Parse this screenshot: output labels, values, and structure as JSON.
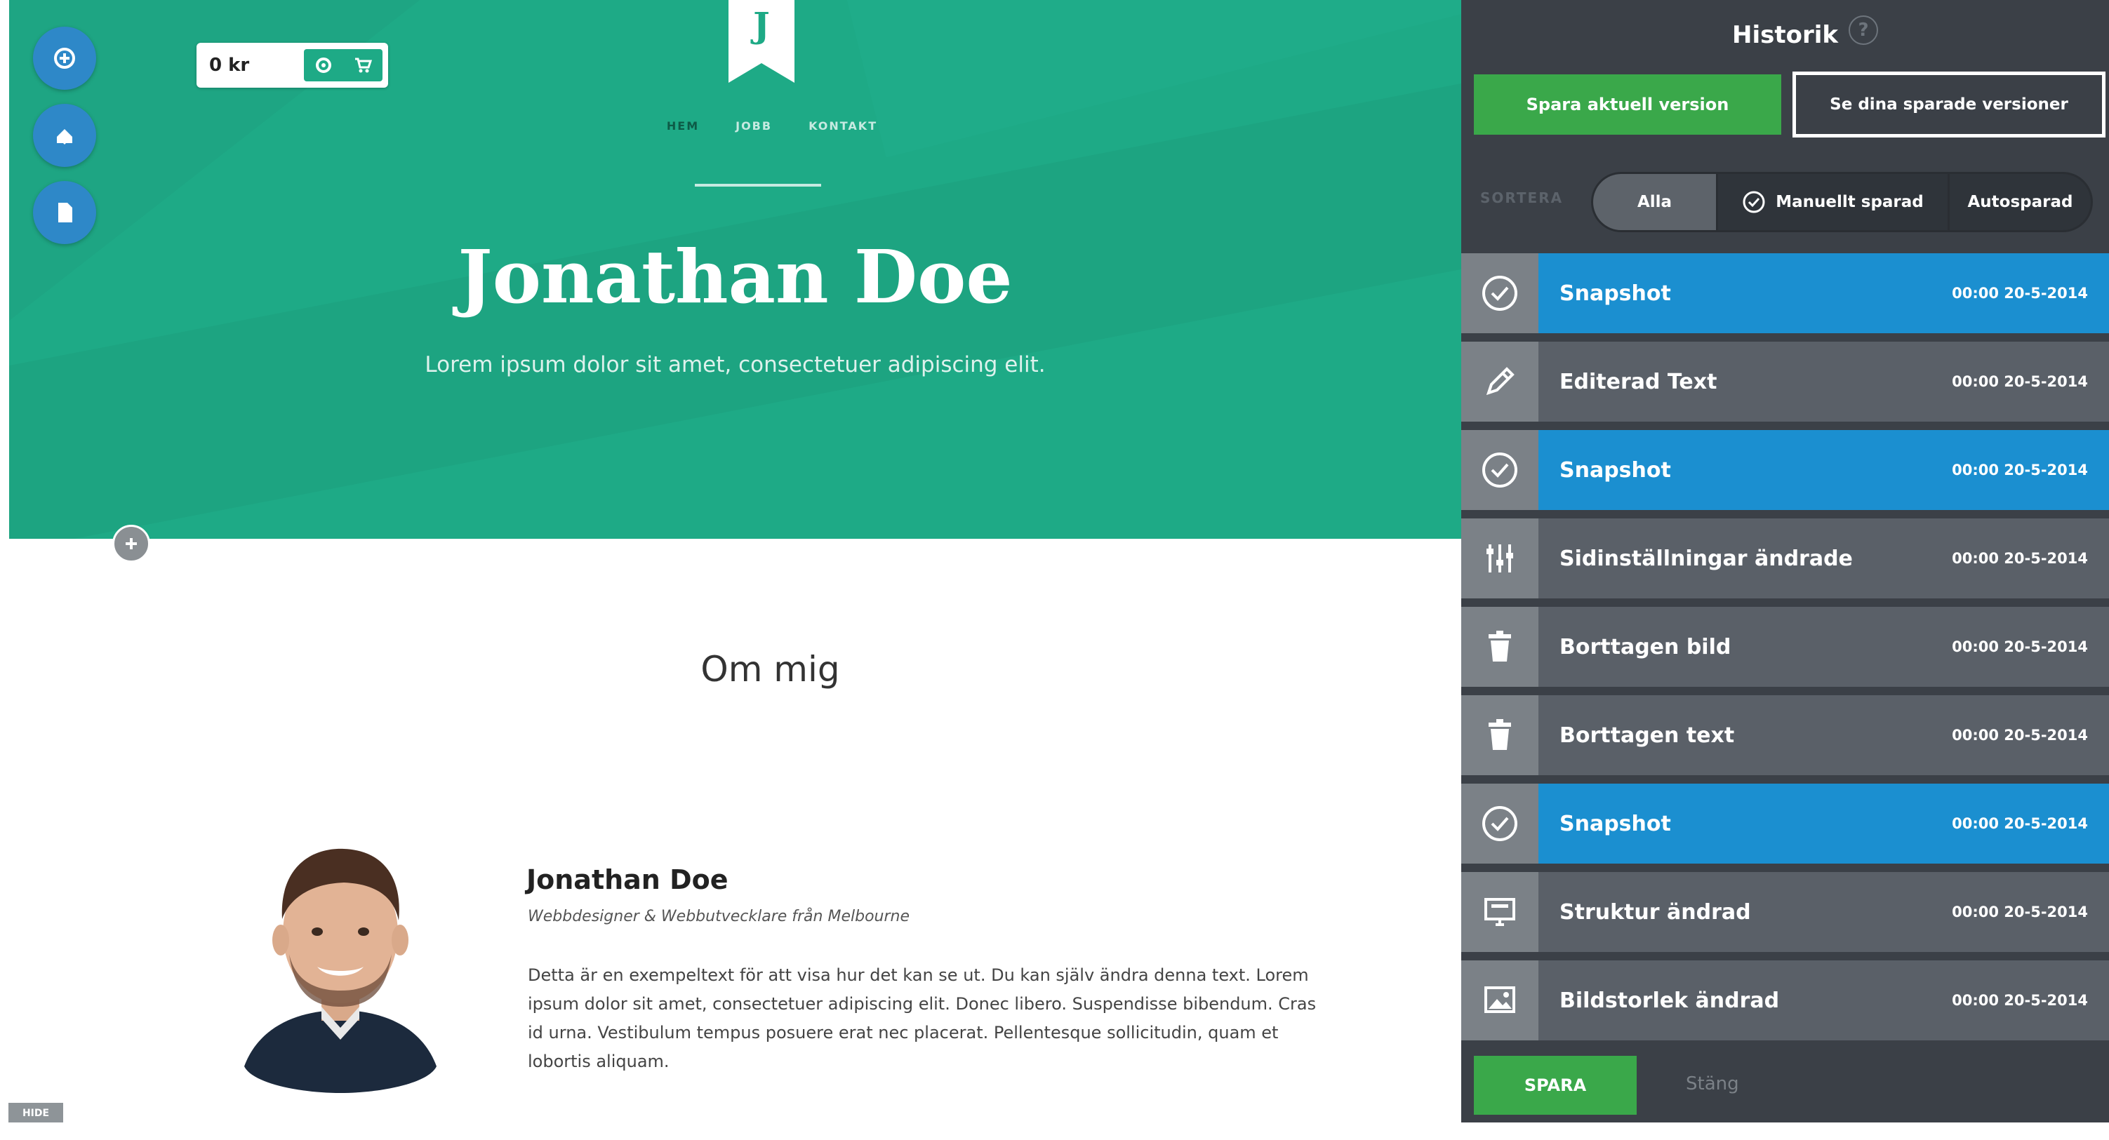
{
  "colors": {
    "hero_green": "#1eaa86",
    "panel_dark": "#3b4047",
    "snapshot_blue": "#1b8fd0",
    "action_green": "#3aa84a",
    "fab_blue": "#2e88c8"
  },
  "editor": {
    "tool_buttons": [
      {
        "icon": "plus-circle-icon"
      },
      {
        "icon": "paint-bucket-icon"
      },
      {
        "icon": "page-icon"
      }
    ],
    "cart": {
      "amount": "0 kr",
      "icons": [
        "gear-icon",
        "cart-icon"
      ]
    },
    "logo_letter": "J",
    "nav": [
      "HEM",
      "JOBB",
      "KONTAKT"
    ],
    "hero_title": "Jonathan Doe",
    "hero_subtitle": "Lorem ipsum dolor sit amet, consectetuer adipiscing elit.",
    "about_heading": "Om mig",
    "profile": {
      "name": "Jonathan Doe",
      "role": "Webbdesigner & Webbutvecklare från Melbourne",
      "bio": "Detta är en exempeltext för att visa hur det kan se ut. Du kan själv ändra denna text. Lorem ipsum dolor sit amet, consectetuer adipiscing elit. Donec libero. Suspendisse bibendum. Cras id urna. Vestibulum tempus posuere erat nec placerat. Pellentesque sollicitudin, quam et lobortis aliquam."
    },
    "corner_tag": "HIDE"
  },
  "panel": {
    "title": "Historik",
    "help": "?",
    "save_version_label": "Spara aktuell version",
    "saved_versions_label": "Se dina sparade versioner",
    "sort_label": "SORTERA",
    "sort_options": [
      "Alla",
      "Manuellt sparad",
      "Autosparad"
    ],
    "sort_selected": "Alla",
    "history": [
      {
        "label": "Snapshot",
        "time": "00:00 20-5-2014",
        "icon": "check-circle-icon",
        "type": "snapshot"
      },
      {
        "label": "Editerad Text",
        "time": "00:00 20-5-2014",
        "icon": "pencil-icon",
        "type": "edit"
      },
      {
        "label": "Snapshot",
        "time": "00:00 20-5-2014",
        "icon": "check-circle-icon",
        "type": "snapshot"
      },
      {
        "label": "Sidinställningar ändrade",
        "time": "00:00 20-5-2014",
        "icon": "sliders-icon",
        "type": "edit"
      },
      {
        "label": "Borttagen bild",
        "time": "00:00 20-5-2014",
        "icon": "trash-icon",
        "type": "edit"
      },
      {
        "label": "Borttagen text",
        "time": "00:00 20-5-2014",
        "icon": "trash-icon",
        "type": "edit"
      },
      {
        "label": "Snapshot",
        "time": "00:00 20-5-2014",
        "icon": "check-circle-icon",
        "type": "snapshot"
      },
      {
        "label": "Struktur ändrad",
        "time": "00:00 20-5-2014",
        "icon": "monitor-icon",
        "type": "edit"
      },
      {
        "label": "Bildstorlek ändrad",
        "time": "00:00 20-5-2014",
        "icon": "image-icon",
        "type": "edit"
      }
    ],
    "spara_label": "SPARA",
    "stang_label": "Stäng"
  }
}
